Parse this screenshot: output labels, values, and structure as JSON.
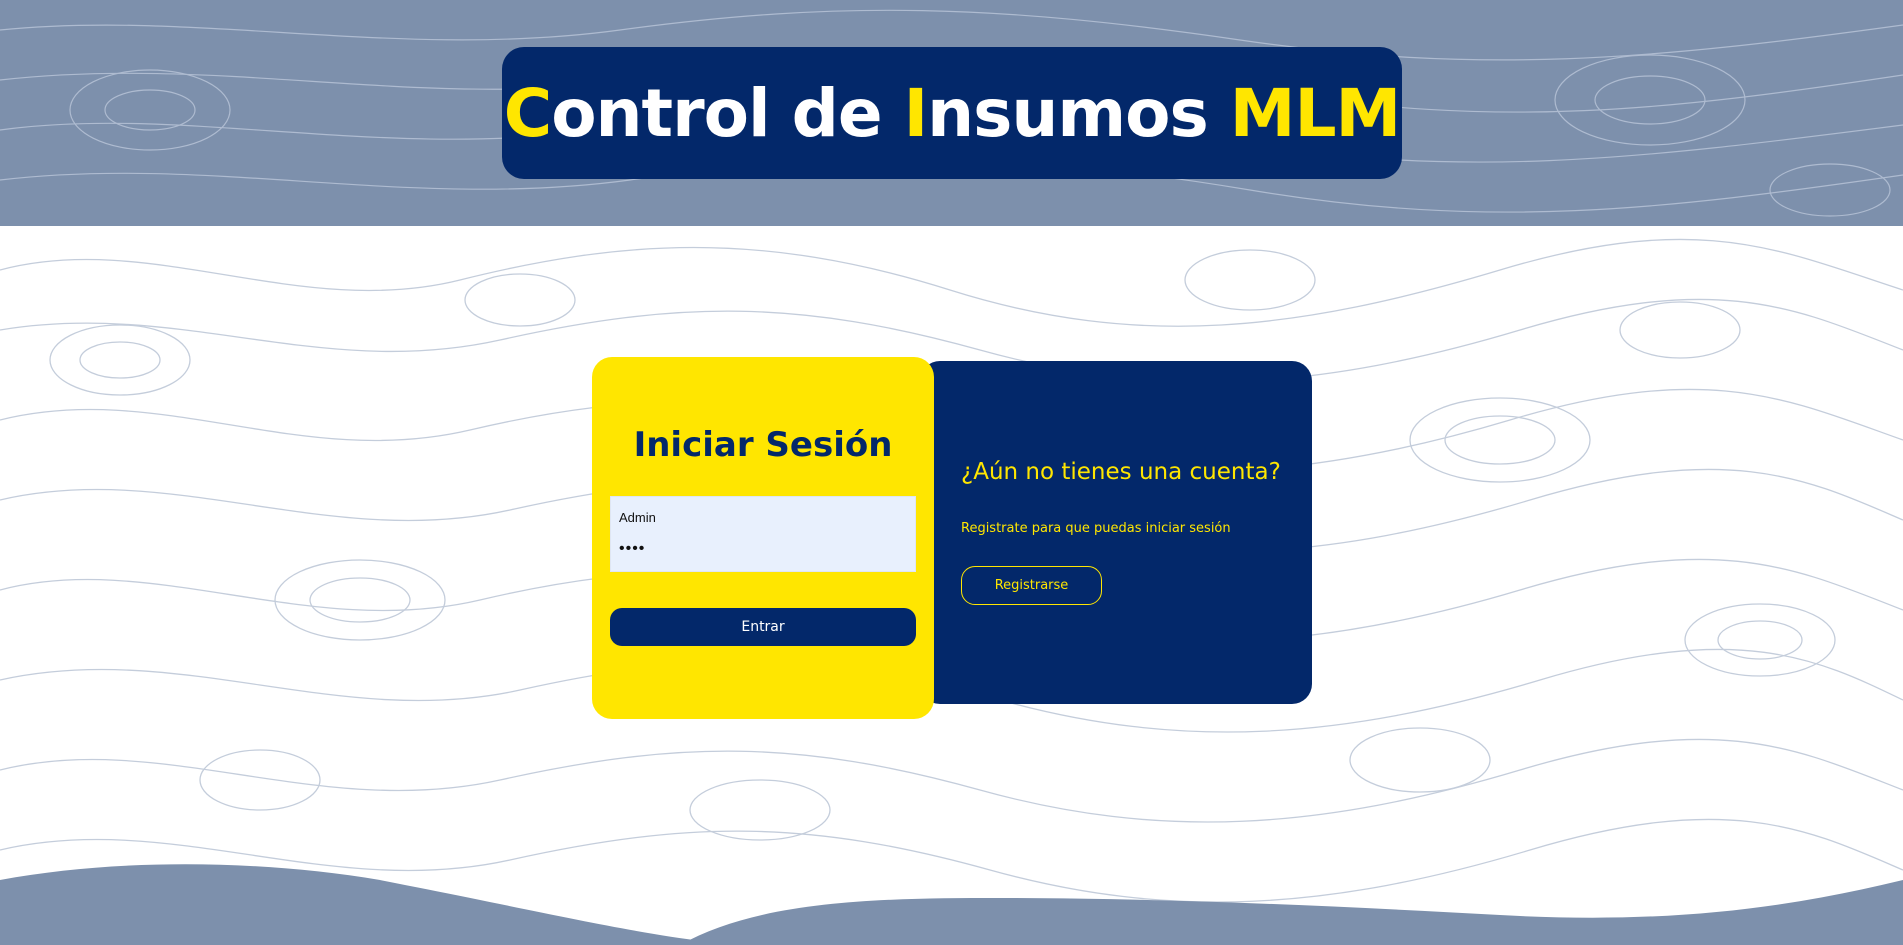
{
  "header": {
    "title_parts": [
      {
        "text": "C",
        "highlight": true
      },
      {
        "text": "ontrol de ",
        "highlight": false
      },
      {
        "text": "I",
        "highlight": true
      },
      {
        "text": "nsumos ",
        "highlight": false
      },
      {
        "text": "MLM",
        "highlight": true
      }
    ]
  },
  "login": {
    "heading": "Iniciar Sesión",
    "username_value": "Admin",
    "password_value": "••••",
    "submit_label": "Entrar"
  },
  "register": {
    "heading": "¿Aún no tienes una cuenta?",
    "text": "Registrate para que puedas iniciar sesión",
    "button_label": "Registrarse"
  },
  "colors": {
    "navy": "#03286a",
    "yellow": "#ffe600",
    "header_band": "#7d90ac",
    "input_bg": "#e8f0fd",
    "topo_lines": "#c4cddb"
  }
}
